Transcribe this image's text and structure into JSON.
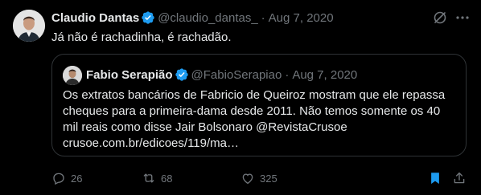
{
  "tweet": {
    "author_name": "Claudio Dantas",
    "author_handle": "@claudio_dantas_",
    "separator": "·",
    "date": "Aug 7, 2020",
    "text": "Já não é rachadinha, é rachadão.",
    "icons": [
      "verified-badge-icon",
      "grok-icon",
      "more-icon"
    ]
  },
  "quote": {
    "author_name": "Fabio Serapião",
    "author_handle": "@FabioSerapiao",
    "separator": "·",
    "date": "Aug 7, 2020",
    "text_lines": [
      "Os extratos bancários de Fabricio de Queiroz mostram que ele repassa",
      "cheques para a primeira-dama desde 2011. Não temos somente os 40",
      "mil reais como disse Jair Bolsonaro @RevistaCrusoe",
      "crusoe.com.br/edicoes/119/ma…"
    ]
  },
  "actions": {
    "replies": "26",
    "retweets": "68",
    "likes": "325",
    "icons": [
      "reply-icon",
      "retweet-icon",
      "like-icon",
      "bookmark-icon",
      "share-icon"
    ],
    "accent_color": "#1d9bf0"
  }
}
